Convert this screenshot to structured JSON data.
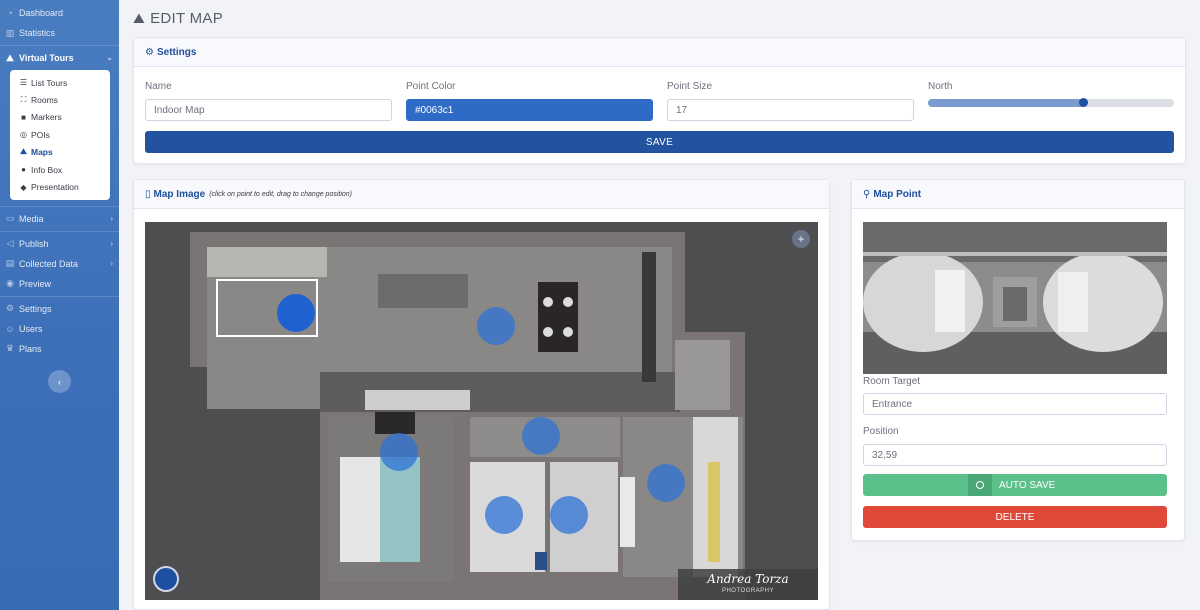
{
  "sidebar": {
    "items_top": [
      {
        "label": "Dashboard",
        "icon": "dashboard-icon"
      },
      {
        "label": "Statistics",
        "icon": "chart-icon"
      }
    ],
    "virtual_tours": {
      "label": "Virtual Tours",
      "icon": "virtual-tours-icon"
    },
    "submenu": [
      {
        "label": "List Tours",
        "icon": "list-icon",
        "glyph": "☰"
      },
      {
        "label": "Rooms",
        "icon": "rooms-icon",
        "glyph": "⛶"
      },
      {
        "label": "Markers",
        "icon": "markers-icon",
        "glyph": "■"
      },
      {
        "label": "POIs",
        "icon": "poi-icon",
        "glyph": "◎"
      },
      {
        "label": "Maps",
        "icon": "maps-icon",
        "glyph": "⛰"
      },
      {
        "label": "Info Box",
        "icon": "info-icon",
        "glyph": "●"
      },
      {
        "label": "Presentation",
        "icon": "presentation-icon",
        "glyph": "◆"
      }
    ],
    "items_bottom": [
      {
        "label": "Media",
        "icon": "media-icon",
        "chevron": true
      },
      {
        "label": "Publish",
        "icon": "publish-icon",
        "chevron": true
      },
      {
        "label": "Collected Data",
        "icon": "collected-data-icon",
        "chevron": true
      },
      {
        "label": "Preview",
        "icon": "preview-icon",
        "chevron": false
      },
      {
        "label": "Settings",
        "icon": "settings-icon",
        "chevron": false
      },
      {
        "label": "Users",
        "icon": "users-icon",
        "chevron": false
      },
      {
        "label": "Plans",
        "icon": "plans-icon",
        "chevron": false
      }
    ],
    "collapse_glyph": "‹"
  },
  "header": {
    "title": "EDIT MAP"
  },
  "settings": {
    "title": "Settings",
    "name_label": "Name",
    "name_value": "Indoor Map",
    "color_label": "Point Color",
    "color_value": "#0063c1",
    "size_label": "Point Size",
    "size_value": "17",
    "north_label": "North",
    "north_fraction": 0.63,
    "save_label": "SAVE"
  },
  "map_image": {
    "title": "Map Image",
    "hint": "(click on point to edit, drag to change position)",
    "zoom_glyph": "+",
    "watermark_name": "Andrea Torza",
    "watermark_sub": "PHOTOGRAPHY",
    "points_color": "#2f73d6"
  },
  "map_point": {
    "title": "Map Point",
    "room_target_label": "Room Target",
    "room_target_value": "Entrance",
    "position_label": "Position",
    "position_value": "32,59",
    "autosave_label": "AUTO SAVE",
    "delete_label": "DELETE"
  },
  "colors": {
    "primary": "#23539e",
    "success": "#5cc08a",
    "danger": "#e0483a"
  }
}
